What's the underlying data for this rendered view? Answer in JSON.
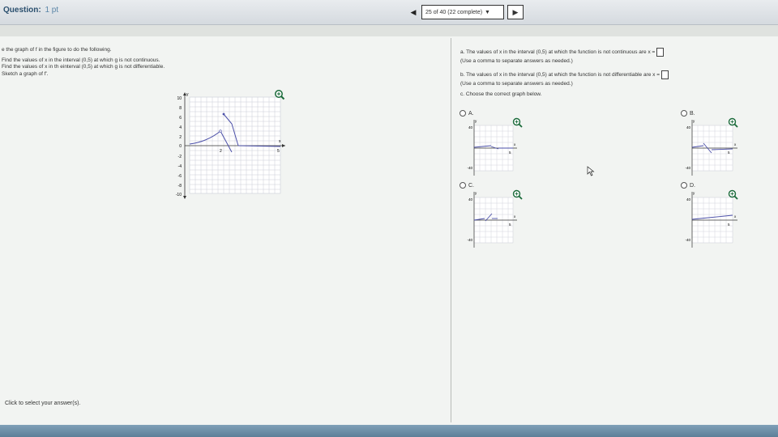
{
  "header": {
    "question_label": "Question:",
    "question_points": "1 pt",
    "nav_position": "25 of 40 (22 complete)",
    "prev_icon": "triangle-left-icon",
    "next_icon": "triangle-right-icon",
    "dropdown_icon": "caret-down-icon"
  },
  "instructions": {
    "line1": "e the graph of f in the figure to do the following.",
    "line2": "Find the values of x in the interval (0,5) at which g is not continuous.",
    "line3": "Find the values of x in th einterval (0,5) at which g is not differentiable.",
    "line4": "Sketch a graph of f'."
  },
  "main_graph": {
    "y_axis_label": "y",
    "x_axis_label": "x",
    "y_ticks": [
      "10",
      "8",
      "6",
      "4",
      "2",
      "0",
      "-2",
      "-4",
      "-6",
      "-8",
      "-10"
    ],
    "x_ticks": [
      "2",
      "5"
    ]
  },
  "parts": {
    "a_prompt": "a. The values of x in the interval (0,5) at which the function is not continuous are x =",
    "a_hint": "(Use a comma to separate answers as needed.)",
    "b_prompt": "b. The values of x in the interval (0,5) at which the function is not differentiable are x =",
    "b_hint": "(Use a comma to separate answers as needed.)",
    "c_prompt": "c. Choose the correct graph below."
  },
  "options": {
    "a_label": "A.",
    "b_label": "B.",
    "c_label": "C.",
    "d_label": "D.",
    "y_label": "y",
    "x_label": "x",
    "top_tick": "40",
    "bottom_tick": "-40",
    "x_tick": "5"
  },
  "footer": {
    "hint": "Click to select your answer(s)."
  },
  "colors": {
    "curve": "#4b4fa8",
    "grid": "#c9ccd6",
    "zoom_icon": "#1a6a3a"
  }
}
